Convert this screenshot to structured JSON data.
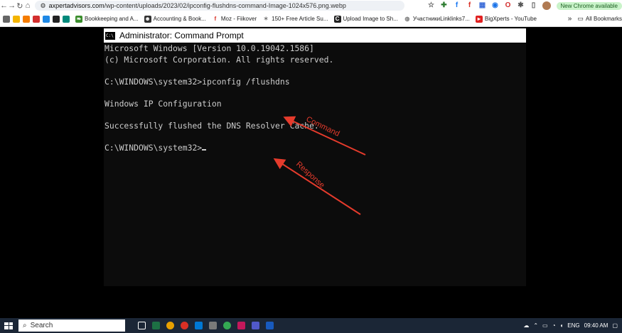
{
  "browser": {
    "url_host": "axpertadvisors.com",
    "url_path": "/wp-content/uploads/2023/02/ipconfig-flushdns-command-Image-1024x576.png.webp",
    "new_chrome_badge": "New Chrome available",
    "bookmarks": [
      {
        "label": "Bookkeeping and A...",
        "icon": "leaf-icon",
        "color": "#3a8d2c"
      },
      {
        "label": "Accounting & Book...",
        "icon": "person-icon",
        "color": "#333333"
      },
      {
        "label": "Moz - Fiikover",
        "icon": "facebook-icon",
        "color": "#d93025"
      },
      {
        "label": "150+ Free Article Su...",
        "icon": "star-icon",
        "color": "#7b7b7b"
      },
      {
        "label": "Upload Image to Sh...",
        "icon": "c-icon",
        "color": "#222222"
      },
      {
        "label": "УчастникиLinklinks7...",
        "icon": "globe-icon",
        "color": "#7b7b7b"
      },
      {
        "label": "BigXperts - YouTube",
        "icon": "youtube-icon",
        "color": "#e02020"
      }
    ],
    "all_bookmarks": "All Bookmarks"
  },
  "console": {
    "title": "Administrator: Command Prompt",
    "lines": [
      "Microsoft Windows [Version 10.0.19042.1586]",
      "(c) Microsoft Corporation. All rights reserved.",
      "",
      "C:\\WINDOWS\\system32>ipconfig /flushdns",
      "",
      "Windows IP Configuration",
      "",
      "Successfully flushed the DNS Resolver Cache.",
      "",
      "C:\\WINDOWS\\system32>"
    ]
  },
  "annotations": {
    "command_label": "Command",
    "response_label": "Response",
    "arrow_color": "#e53b2c"
  },
  "taskbar": {
    "search_placeholder": "Search",
    "language": "ENG",
    "time": "09:40 AM"
  }
}
